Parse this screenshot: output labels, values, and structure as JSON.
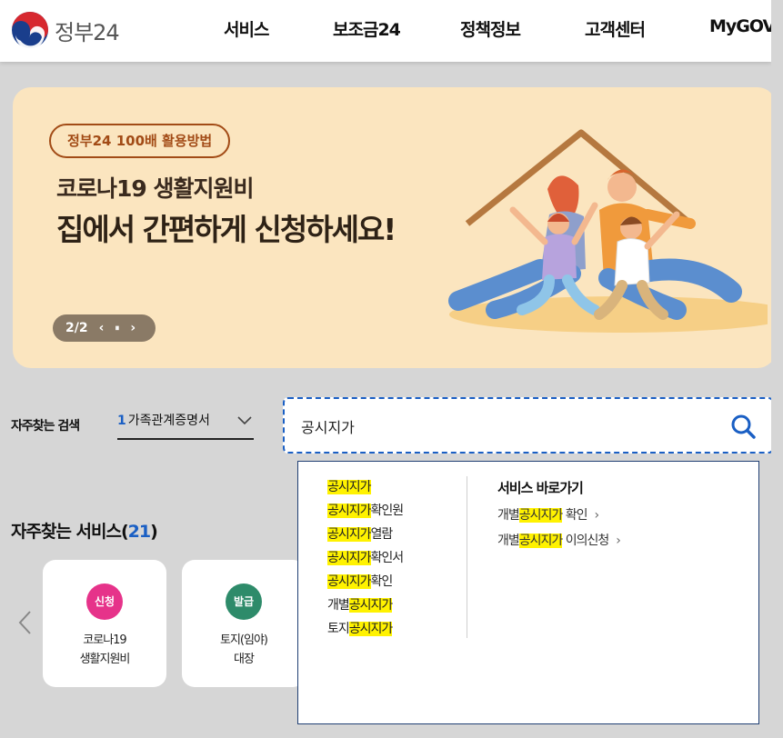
{
  "header": {
    "logo_text": "정부24",
    "nav": [
      "서비스",
      "보조금24",
      "정책정보",
      "고객센터",
      "MyGOV"
    ]
  },
  "banner": {
    "badge": "정부24 100배 활용방법",
    "subtitle": "코로나19 생활지원비",
    "title": "집에서 간편하게 신청하세요!",
    "pager": "2/2",
    "prev": "‹",
    "pause": "⏸",
    "next": "›"
  },
  "search": {
    "label": "자주찾는 검색",
    "select_rank": "1",
    "select_value": "가족관계증명서",
    "input_value": "공시지가"
  },
  "suggest": {
    "items": [
      {
        "pre": "",
        "hl": "공시지가",
        "post": ""
      },
      {
        "pre": "",
        "hl": "공시지가",
        "post": "확인원"
      },
      {
        "pre": "",
        "hl": "공시지가",
        "post": "열람"
      },
      {
        "pre": "",
        "hl": "공시지가",
        "post": "확인서"
      },
      {
        "pre": "",
        "hl": "공시지가",
        "post": "확인"
      },
      {
        "pre": "개별",
        "hl": "공시지가",
        "post": ""
      },
      {
        "pre": "토지",
        "hl": "공시지가",
        "post": ""
      }
    ],
    "service_title": "서비스 바로가기",
    "services": [
      {
        "pre": "개별",
        "hl": "공시지가",
        "post": " 확인",
        "arrow": "›"
      },
      {
        "pre": "개별",
        "hl": "공시지가",
        "post": " 이의신청",
        "arrow": "›"
      }
    ]
  },
  "favorites": {
    "title": "자주찾는 서비스(",
    "count": "21",
    "close": ")",
    "cards": [
      {
        "tag": "신청",
        "tag_color": "#e6338a",
        "line1": "코로나19",
        "line2": "생활지원비"
      },
      {
        "tag": "발급",
        "tag_color": "#2e8b6a",
        "line1": "토지(임야)",
        "line2": "대장"
      }
    ]
  }
}
